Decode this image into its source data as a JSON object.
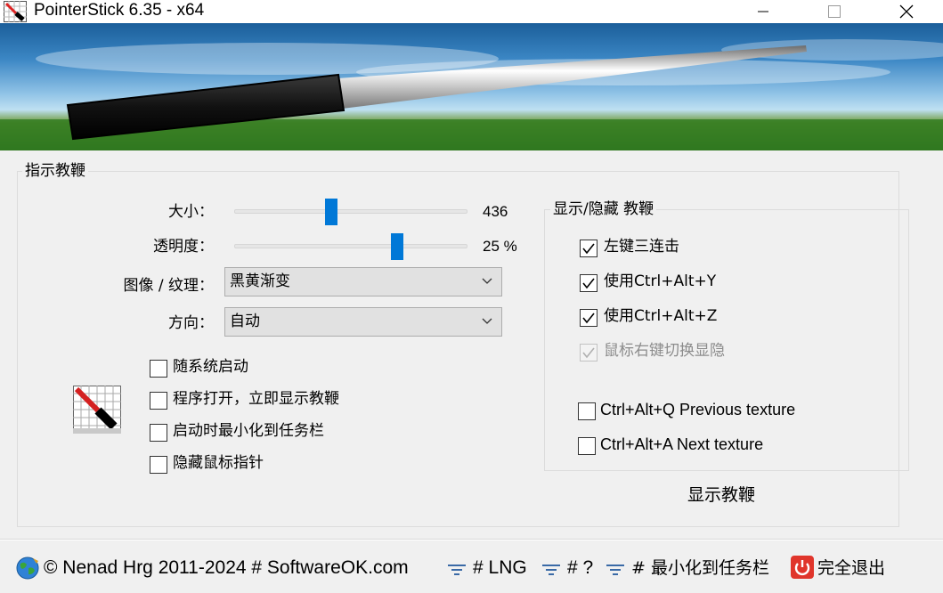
{
  "window": {
    "title": "PointerStick 6.35 - x64",
    "controls": [
      "minimize",
      "maximize",
      "close"
    ]
  },
  "icons": {
    "app": "pointerstick-app-icon",
    "minimize": "minimize-icon",
    "maximize": "maximize-icon",
    "close": "close-icon",
    "globe": "globe-icon",
    "menu": "menu-lines-icon",
    "power": "power-icon",
    "large_app": "pointerstick-large-icon"
  },
  "pointer_group": {
    "title": "指示教鞭",
    "size": {
      "label": "大小：",
      "value": "436",
      "level": 0.41
    },
    "opacity": {
      "label": "透明度：",
      "value": "25 %",
      "level": 0.71
    },
    "texture": {
      "label": "图像 / 纹理：",
      "selected": "黑黄渐变"
    },
    "direction": {
      "label": "方向：",
      "selected": "自动"
    },
    "checkboxes": [
      {
        "label": "随系统启动",
        "checked": false
      },
      {
        "label": "程序打开，立即显示教鞭",
        "checked": false
      },
      {
        "label": "启动时最小化到任务栏",
        "checked": false
      },
      {
        "label": "隐藏鼠标指针",
        "checked": false
      }
    ]
  },
  "showhide_group": {
    "title": "显示/隐藏 教鞭",
    "checkboxes": [
      {
        "label": "左键三连击",
        "checked": true,
        "enabled": true
      },
      {
        "label": "使用Ctrl+Alt+Y",
        "checked": true,
        "enabled": true
      },
      {
        "label": "使用Ctrl+Alt+Z",
        "checked": true,
        "enabled": true
      },
      {
        "label": "鼠标右键切换显隐",
        "checked": true,
        "enabled": false
      },
      {
        "label": "Ctrl+Alt+Q Previous texture",
        "checked": false,
        "enabled": true
      },
      {
        "label": "Ctrl+Alt+A Next texture",
        "checked": false,
        "enabled": true
      }
    ],
    "show_button": "显示教鞭"
  },
  "footer": {
    "copyright": "© Nenad Hrg 2011-2024 # SoftwareOK.com",
    "lng": "# LNG",
    "help": "# ?",
    "minimize": "# 最小化到任务栏",
    "exit": "完全退出"
  },
  "colors": {
    "accent": "#0078d7",
    "background": "#f0f0f0",
    "power_red": "#e0352b"
  }
}
